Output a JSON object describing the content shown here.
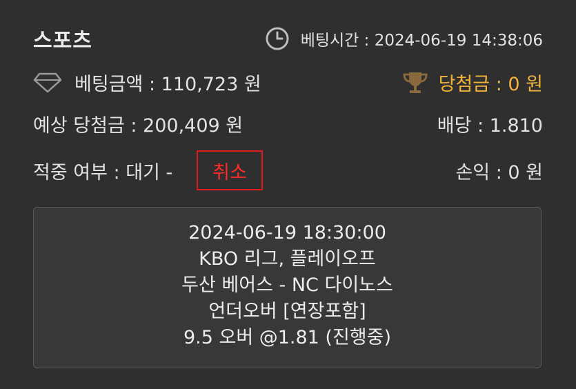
{
  "header": {
    "title": "스포츠",
    "bet_time": "베팅시간 : 2024-06-19 14:38:06"
  },
  "stats": {
    "bet_amount": "베팅금액 : 110,723 원",
    "winnings": "당첨금 : 0 원",
    "expected_winnings": "예상 당첨금 : 200,409 원",
    "odds": "배당 : 1.810",
    "hit_status": "적중 여부 : 대기 -",
    "profit_loss": "손익 : 0 원"
  },
  "actions": {
    "cancel_label": "취소"
  },
  "detail": {
    "lines": [
      "2024-06-19 18:30:00",
      "KBO 리그, 플레이오프",
      "두산 베어스 - NC 다이노스",
      "언더오버 [연장포함]",
      "9.5 오버 @1.81 (진행중)"
    ]
  },
  "colors": {
    "background": "#2f2f2f",
    "accent_gold": "#f0b33a",
    "cancel_red": "#e01b1b"
  },
  "icons": {
    "clock": "clock-icon",
    "diamond": "diamond-icon",
    "trophy": "trophy-icon"
  }
}
